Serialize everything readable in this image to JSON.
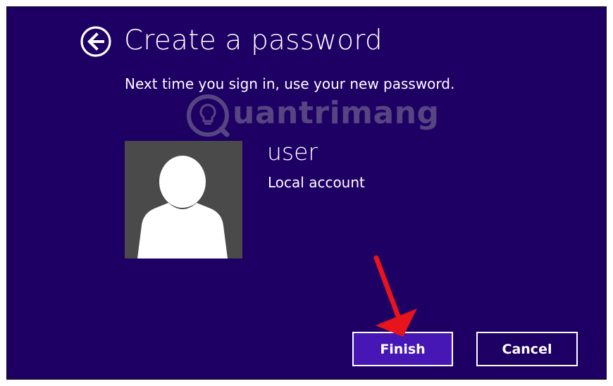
{
  "header": {
    "back_icon": "back-arrow-circle-icon",
    "title": "Create a password"
  },
  "subtitle": "Next time you sign in, use your new password.",
  "watermark": {
    "text": "uantrimang",
    "icon": "lightbulb-logo-icon"
  },
  "account": {
    "avatar_icon": "user-silhouette-icon",
    "name": "user",
    "type": "Local account"
  },
  "buttons": {
    "finish_label": "Finish",
    "cancel_label": "Cancel"
  },
  "annotation": {
    "icon": "red-arrow-icon",
    "color": "#e8141b"
  },
  "colors": {
    "background": "#1e0064",
    "primary_button": "#4617b4",
    "text": "#ffffff",
    "avatar_bg": "#4a4a4a"
  }
}
